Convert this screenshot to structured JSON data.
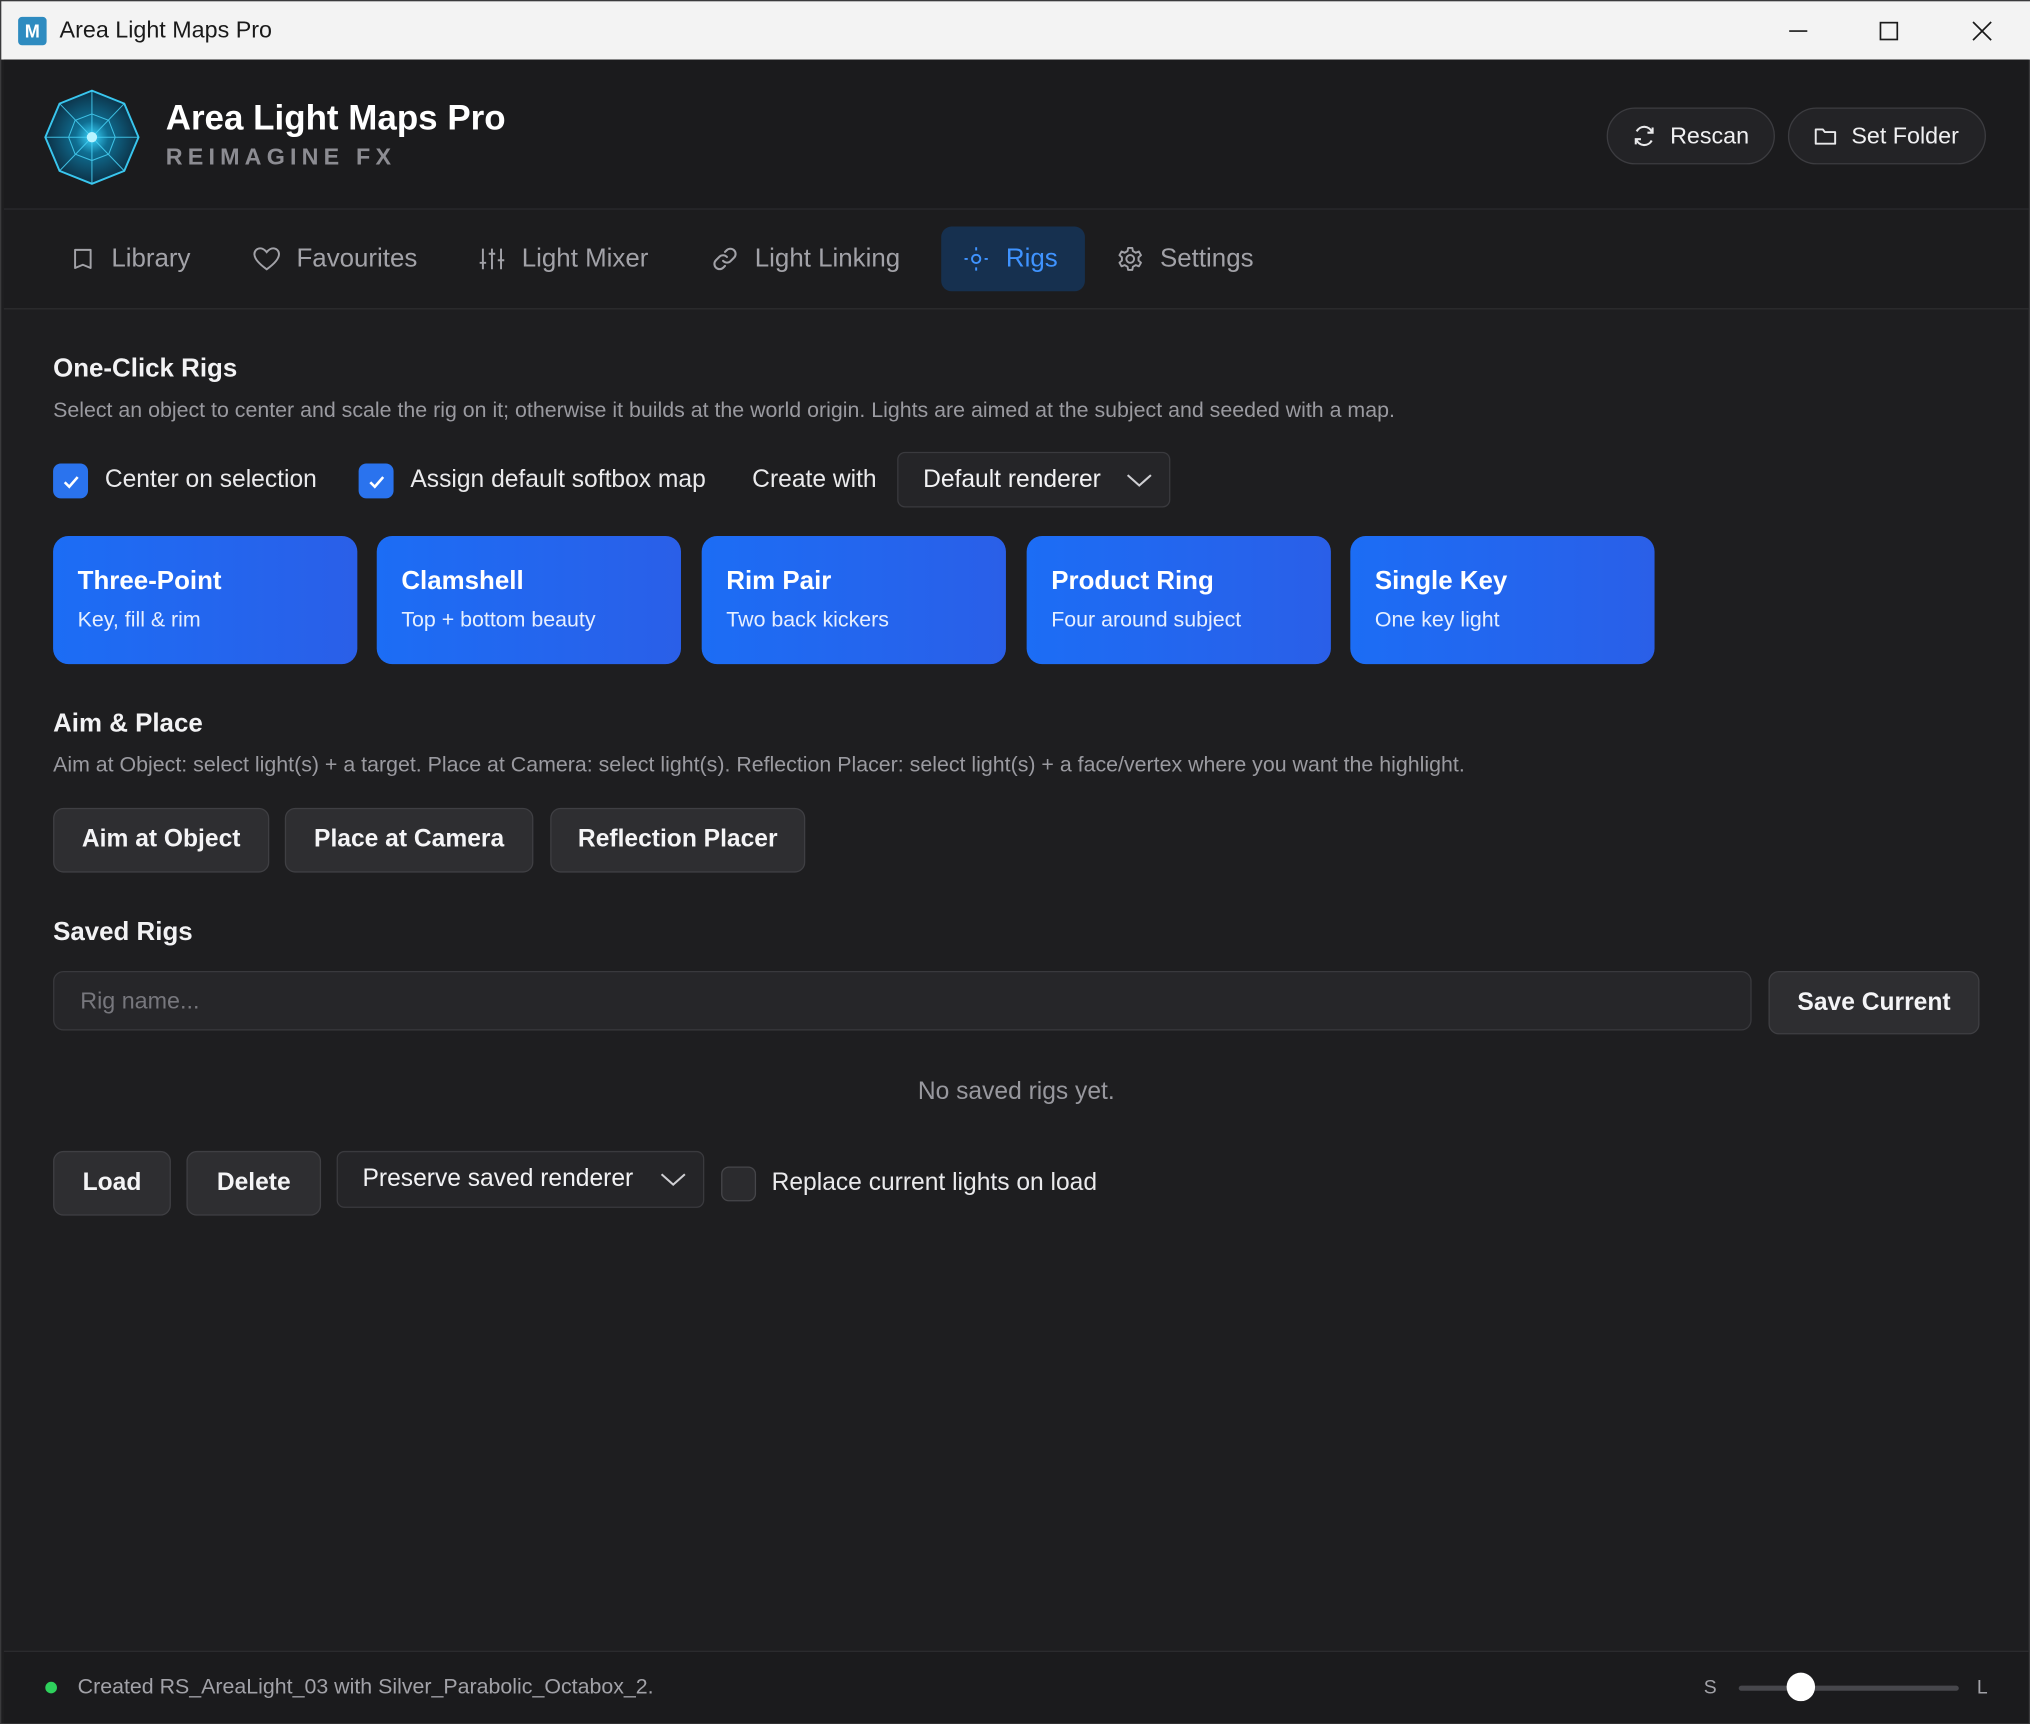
{
  "window": {
    "title": "Area Light Maps Pro",
    "app_icon_letter": "M"
  },
  "header": {
    "title": "Area Light Maps Pro",
    "subtitle": "REIMAGINE FX",
    "rescan_label": "Rescan",
    "set_folder_label": "Set Folder"
  },
  "tabs": [
    {
      "label": "Library",
      "icon": "book-icon"
    },
    {
      "label": "Favourites",
      "icon": "heart-icon"
    },
    {
      "label": "Light Mixer",
      "icon": "sliders-icon"
    },
    {
      "label": "Light Linking",
      "icon": "link-icon"
    },
    {
      "label": "Rigs",
      "icon": "light-bulb-icon",
      "active": true
    },
    {
      "label": "Settings",
      "icon": "gear-icon"
    }
  ],
  "one_click": {
    "title": "One-Click Rigs",
    "description": "Select an object to center and scale the rig on it; otherwise it builds at the world origin. Lights are aimed at the subject and seeded with a map.",
    "center_on_selection_label": "Center on selection",
    "center_on_selection_checked": true,
    "assign_default_label": "Assign default softbox map",
    "assign_default_checked": true,
    "create_with_label": "Create with",
    "renderer_selected": "Default renderer",
    "rigs": [
      {
        "name": "Three-Point",
        "sub": "Key, fill & rim"
      },
      {
        "name": "Clamshell",
        "sub": "Top + bottom beauty"
      },
      {
        "name": "Rim Pair",
        "sub": "Two back kickers"
      },
      {
        "name": "Product Ring",
        "sub": "Four around subject"
      },
      {
        "name": "Single Key",
        "sub": "One key light"
      }
    ]
  },
  "aim_place": {
    "title": "Aim & Place",
    "description": "Aim at Object: select light(s) + a target. Place at Camera: select light(s). Reflection Placer: select light(s) + a face/vertex where you want the highlight.",
    "aim_label": "Aim at Object",
    "place_label": "Place at Camera",
    "reflection_label": "Reflection Placer"
  },
  "saved_rigs": {
    "title": "Saved Rigs",
    "input_placeholder": "Rig name...",
    "input_value": "",
    "save_label": "Save Current",
    "empty_text": "No saved rigs yet.",
    "load_label": "Load",
    "delete_label": "Delete",
    "renderer_mode_selected": "Preserve saved renderer",
    "replace_label": "Replace current lights on load",
    "replace_checked": false
  },
  "status": {
    "message": "Created RS_AreaLight_03 with Silver_Parabolic_Octabox_2.",
    "size_small_label": "S",
    "size_large_label": "L",
    "size_value": 0.28
  },
  "colors": {
    "accent": "#2a73ee",
    "tab_active_text": "#3f93ff",
    "status_ok": "#2ed15c"
  }
}
